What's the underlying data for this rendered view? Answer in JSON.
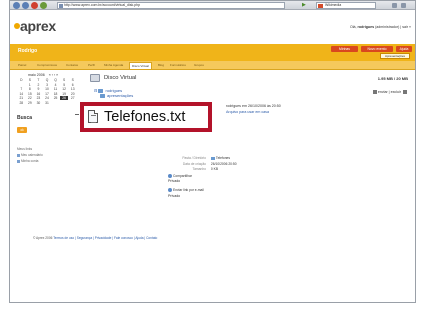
{
  "browser": {
    "url": "http://www.aprex.com.br/account/virtual_disk.php",
    "search_engine": "Wikimedia"
  },
  "app": {
    "logo": "aprex",
    "user_prefix": "Olá,",
    "user_name": "rodrigues",
    "user_suffix": "(administrador) | sair »",
    "section_title": "Rodrigo",
    "top_buttons": [
      "Minhas",
      "Novo evento",
      "Ajuda"
    ],
    "apresentacoes_button": "Apresentações"
  },
  "tabs": [
    "Painel",
    "Compromissos",
    "Contatos",
    "Perfil",
    "Minha Agenda",
    "Disco Virtual",
    "Blog",
    "Formulários",
    "Grupos"
  ],
  "sidebar": {
    "calendar_title": "maio 2006",
    "calendar_nav": "« ‹ › »",
    "weekdays": [
      "D",
      "S",
      "T",
      "Q",
      "Q",
      "S",
      "S"
    ],
    "days": [
      "",
      "1",
      "2",
      "3",
      "4",
      "5",
      "6",
      "7",
      "8",
      "9",
      "10",
      "11",
      "12",
      "13",
      "14",
      "15",
      "16",
      "17",
      "18",
      "19",
      "20",
      "21",
      "22",
      "23",
      "24",
      "25",
      "26",
      "27",
      "28",
      "29",
      "30",
      "31",
      "",
      "",
      ""
    ],
    "today": "26",
    "busca_label": "Busca",
    "busca_button": "ok",
    "links_label": "Meus links",
    "link1": "Meu calendário",
    "link2": "Minha conta"
  },
  "main": {
    "title": "Disco Virtual",
    "quota": "1.95 MB / 20 MB",
    "tree_root": "rodrigues",
    "tree_child": "apresentações",
    "actions": "enviar | excluir",
    "file_name": "Telefones.txt",
    "file_meta": "rodrigues em 26/10/2006 às 20:50",
    "file_note": "Arquivo para usar em casa"
  },
  "properties": {
    "folder_label": "Pasta / Diretório",
    "folder_value": "Telefones",
    "date_label": "Data de criação",
    "date_value": "26/10/2006 20:50",
    "size_label": "Tamanho",
    "size_value": "0 KB",
    "share1_label": "Compartilhar",
    "share1_value": "Privado",
    "share2_label": "Enviar link por e-mail",
    "share2_value": "Privado"
  },
  "footer": {
    "copyright": "© Aprex 2006",
    "links": "Termos de uso | Segurança | Privacidade | Fale conosco | Ajuda | Contato"
  }
}
